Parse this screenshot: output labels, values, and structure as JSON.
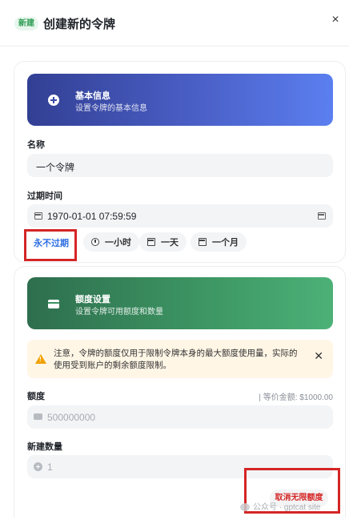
{
  "header": {
    "badge": "新建",
    "title": "创建新的令牌",
    "close_glyph": "×"
  },
  "basic": {
    "banner_title": "基本信息",
    "banner_subtitle": "设置令牌的基本信息",
    "banner_icon": "plus-circle-icon",
    "name_label": "名称",
    "name_value": "一个令牌",
    "expire_label": "过期时间",
    "expire_value": "1970-01-01 07:59:59",
    "quick_options": {
      "never": "永不过期",
      "one_hour": "一小时",
      "one_day": "一天",
      "one_month": "一个月"
    }
  },
  "quota": {
    "banner_title": "额度设置",
    "banner_subtitle": "设置令牌可用额度和数量",
    "banner_icon": "credit-card-icon",
    "notice_line1": "注意，令牌的额度仅用于限制令牌本身的最大额度使用量，实际的",
    "notice_line2": "使用受到账户的剩余额度限制。",
    "quota_label": "额度",
    "quota_hint": "| 等价金额: $1000.00",
    "quota_placeholder": "500000000",
    "count_label": "新建数量",
    "count_placeholder": "1",
    "unlimited_button": "取消无限额度"
  },
  "watermark": "公众号 · gptcat site",
  "colors": {
    "accent_blue": "#2f6fe4",
    "highlight_red": "#d42525",
    "banner_blue": "#4a5fc6",
    "banner_green": "#3c9462",
    "warning": "#f1a100"
  }
}
